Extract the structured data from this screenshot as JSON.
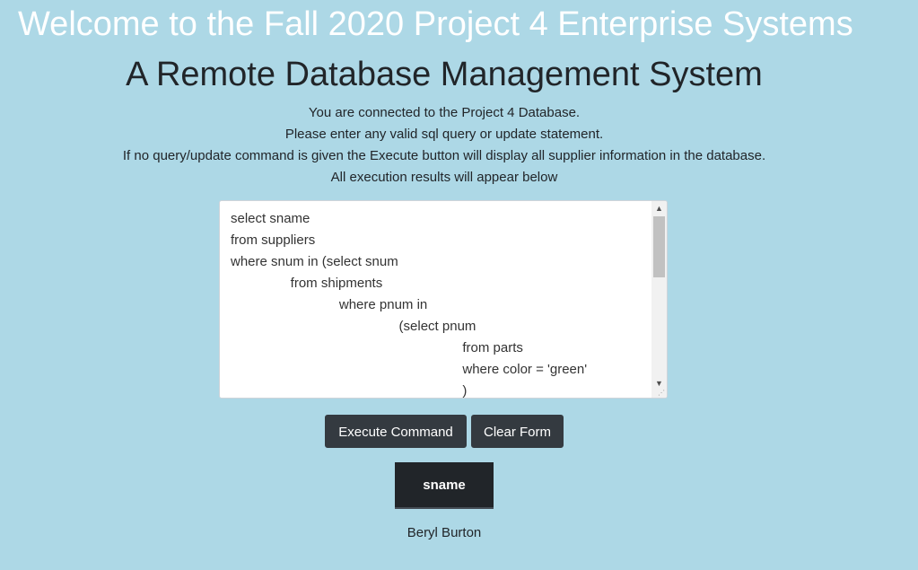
{
  "header": {
    "welcome": "Welcome to the Fall 2020 Project 4 Enterprise Systems",
    "subtitle": "A Remote Database Management System"
  },
  "info": {
    "line1": "You are connected to the Project 4 Database.",
    "line2": "Please enter any valid sql query or update statement.",
    "line3": "If no query/update command is given the Execute button will display all supplier information in the database.",
    "line4": "All execution results will appear below"
  },
  "editor": {
    "value": "select sname\nfrom suppliers\nwhere snum in (select snum\n                from shipments\n                             where pnum in\n                                             (select pnum\n                                                              from parts\n                                                              where color = 'green'\n                                                              )"
  },
  "buttons": {
    "execute_label": "Execute Command",
    "clear_label": "Clear Form"
  },
  "results": {
    "columns": [
      "sname"
    ],
    "rows": [
      [
        "Beryl Burton"
      ]
    ]
  },
  "icons": {
    "scroll_up": "scroll-up-arrow-icon",
    "scroll_down": "scroll-down-arrow-icon",
    "resize": "resize-grip-icon"
  },
  "colors": {
    "background": "#add8e6",
    "button": "#343a40",
    "table_header": "#212529"
  }
}
